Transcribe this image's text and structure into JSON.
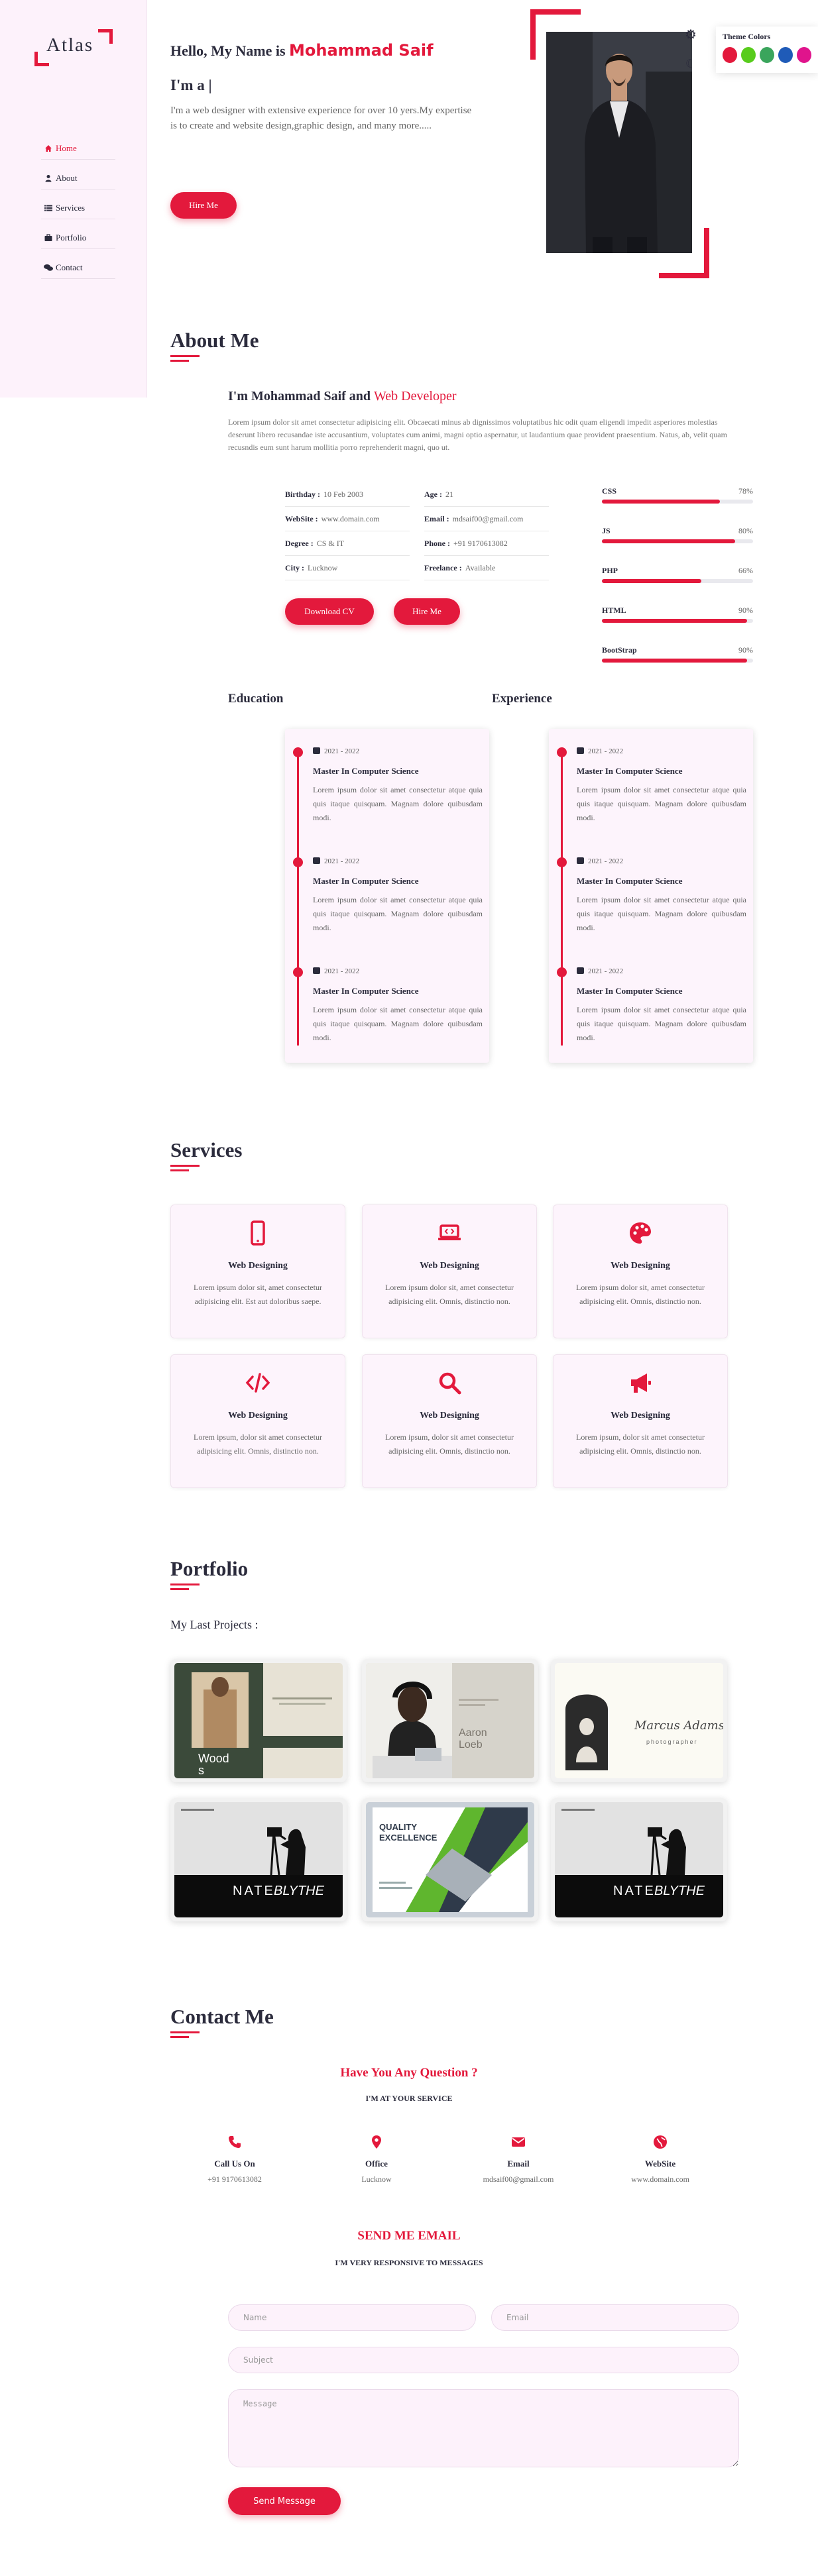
{
  "brand": {
    "logo_text": "Atlas"
  },
  "nav": {
    "items": [
      {
        "label": "Home",
        "icon": "home-icon",
        "active": true
      },
      {
        "label": "About",
        "icon": "user-icon",
        "active": false
      },
      {
        "label": "Services",
        "icon": "list-icon",
        "active": false
      },
      {
        "label": "Portfolio",
        "icon": "briefcase-icon",
        "active": false
      },
      {
        "label": "Contact",
        "icon": "comments-icon",
        "active": false
      }
    ]
  },
  "hero": {
    "greeting": "Hello, My Name is ",
    "name": "Mohammad Saif",
    "typing": "I'm a |",
    "description": "I'm a web designer with extensive experience for over 10 yers.My expertise is to create and website design,graphic design, and many more.....",
    "hire_label": "Hire Me"
  },
  "theme": {
    "title": "Theme Colors",
    "colors": [
      "#e3193c",
      "#58cc1c",
      "#3aa55c",
      "#1f5bb8",
      "#e0148c"
    ]
  },
  "about": {
    "title": "About Me",
    "heading_prefix": "I'm Mohammad Saif and ",
    "heading_role": "Web Developer",
    "paragraph": "Lorem ipsum dolor sit amet consectetur adipisicing elit. Obcaecati minus ab dignissimos voluptatibus hic odit quam eligendi impedit asperiores molestias deserunt libero recusandae iste accusantium, voluptates cum animi, magni optio aspernatur, ut laudantium quae provident praesentium. Natus, ab, velit quam recusndis eum sunt harum mollitia porro reprehenderit magni, quo ut.",
    "info": [
      {
        "label": "Birthday :",
        "value": "10 Feb 2003"
      },
      {
        "label": "Age :",
        "value": "21"
      },
      {
        "label": "WebSite :",
        "value": "www.domain.com"
      },
      {
        "label": "Email :",
        "value": "mdsaif00@gmail.com"
      },
      {
        "label": "Degree :",
        "value": "CS & IT"
      },
      {
        "label": "Phone :",
        "value": "+91 9170613082"
      },
      {
        "label": "City :",
        "value": "Lucknow"
      },
      {
        "label": "Freelance :",
        "value": "Available"
      }
    ],
    "download_label": "Download CV",
    "hire_label": "Hire Me",
    "skills": [
      {
        "name": "CSS",
        "percent": 78,
        "label": "78%"
      },
      {
        "name": "JS",
        "percent": 88,
        "label": "80%"
      },
      {
        "name": "PHP",
        "percent": 66,
        "label": "66%"
      },
      {
        "name": "HTML",
        "percent": 96,
        "label": "90%"
      },
      {
        "name": "BootStrap",
        "percent": 96,
        "label": "90%"
      }
    ]
  },
  "resume": {
    "education_title": "Education",
    "experience_title": "Experience",
    "education": [
      {
        "date": "2021 - 2022",
        "title": "Master In Computer Science",
        "desc": "Lorem ipsum dolor sit amet consectetur atque quia quis itaque quisquam. Magnam dolore quibusdam modi."
      },
      {
        "date": "2021 - 2022",
        "title": "Master In Computer Science",
        "desc": "Lorem ipsum dolor sit amet consectetur atque quia quis itaque quisquam. Magnam dolore quibusdam modi."
      },
      {
        "date": "2021 - 2022",
        "title": "Master In Computer Science",
        "desc": "Lorem ipsum dolor sit amet consectetur atque quia quis itaque quisquam. Magnam dolore quibusdam modi."
      }
    ],
    "experience": [
      {
        "date": "2021 - 2022",
        "title": "Master In Computer Science",
        "desc": "Lorem ipsum dolor sit amet consectetur atque quia quis itaque quisquam. Magnam dolore quibusdam modi."
      },
      {
        "date": "2021 - 2022",
        "title": "Master In Computer Science",
        "desc": "Lorem ipsum dolor sit amet consectetur atque quia quis itaque quisquam. Magnam dolore quibusdam modi."
      },
      {
        "date": "2021 - 2022",
        "title": "Master In Computer Science",
        "desc": "Lorem ipsum dolor sit amet consectetur atque quia quis itaque quisquam. Magnam dolore quibusdam modi."
      }
    ]
  },
  "services": {
    "title": "Services",
    "items": [
      {
        "icon": "mobile-icon",
        "title": "Web Designing",
        "desc": "Lorem ipsum dolor sit, amet consectetur adipisicing elit. Est aut doloribus saepe."
      },
      {
        "icon": "laptop-code-icon",
        "title": "Web Designing",
        "desc": "Lorem ipsum dolor sit, amet consectetur adipisicing elit. Omnis, distinctio non."
      },
      {
        "icon": "palette-icon",
        "title": "Web Designing",
        "desc": "Lorem ipsum dolor sit, amet consectetur adipisicing elit. Omnis, distinctio non."
      },
      {
        "icon": "code-icon",
        "title": "Web Designing",
        "desc": "Lorem ipsum, dolor sit amet consectetur adipisicing elit. Omnis, distinctio non."
      },
      {
        "icon": "search-icon",
        "title": "Web Designing",
        "desc": "Lorem ipsum, dolor sit amet consectetur adipisicing elit. Omnis, distinctio non."
      },
      {
        "icon": "bullhorn-icon",
        "title": "Web Designing",
        "desc": "Lorem ipsum, dolor sit amet consectetur adipisicing elit. Omnis, distinctio non."
      }
    ]
  },
  "portfolio": {
    "title": "Portfolio",
    "subtitle": "My Last Projects :",
    "items": [
      {
        "name": "woods-project",
        "text1": "Wood",
        "text2": "s"
      },
      {
        "name": "aaron-project",
        "text1": "Aaron",
        "text2": "Loeb"
      },
      {
        "name": "signature-project",
        "text1": "Marcus Adams",
        "text2": "photographer"
      },
      {
        "name": "nate-blythe-project-1",
        "text1": "NATE",
        "text2": "BLYTHE"
      },
      {
        "name": "quality-excellence-project",
        "text1": "QUALITY",
        "text2": "EXCELLENCE"
      },
      {
        "name": "nate-blythe-project-2",
        "text1": "NATE",
        "text2": "BLYTHE"
      }
    ]
  },
  "contact": {
    "title": "Contact Me",
    "question": "Have You Any Question ?",
    "service_sub": "I'M AT YOUR SERVICE",
    "items": [
      {
        "icon": "phone-icon",
        "title": "Call Us On",
        "value": "+91 9170613082"
      },
      {
        "icon": "location-pin-icon",
        "title": "Office",
        "value": "Lucknow"
      },
      {
        "icon": "envelope-icon",
        "title": "Email",
        "value": "mdsaif00@gmail.com"
      },
      {
        "icon": "globe-icon",
        "title": "WebSite",
        "value": "www.domain.com"
      }
    ],
    "email_title": "SEND ME EMAIL",
    "email_sub": "I'M VERY RESPONSIVE TO MESSAGES",
    "placeholders": {
      "name": "Name",
      "email": "Email",
      "subject": "Subject",
      "message": "Message"
    },
    "send_label": "Send Message"
  }
}
